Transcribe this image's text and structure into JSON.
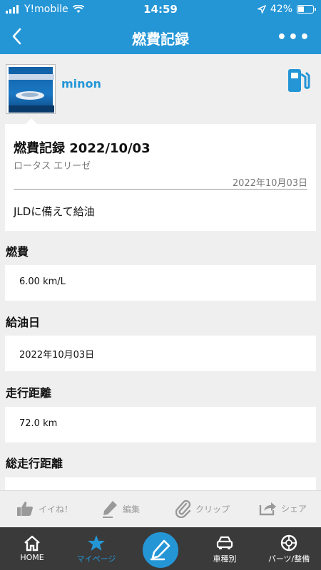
{
  "status": {
    "carrier": "Y!mobile",
    "time": "14:59",
    "battery": "42%",
    "battery_level": 0.42
  },
  "nav": {
    "title": "燃費記録",
    "more_icon": "•••"
  },
  "profile": {
    "username": "minon"
  },
  "record": {
    "title": "燃費記録 2022/10/03",
    "car": "ロータス エリーゼ",
    "date": "2022年10月03日",
    "comment": "JLDに備えて給油"
  },
  "fields": [
    {
      "label": "燃費",
      "value": "6.00 km/L"
    },
    {
      "label": "給油日",
      "value": "2022年10月03日"
    },
    {
      "label": "走行距離",
      "value": "72.0 km"
    },
    {
      "label": "総走行距離",
      "value": ""
    }
  ],
  "actions": {
    "like": "イイね！",
    "edit": "編集",
    "clip": "クリップ",
    "share": "シェア"
  },
  "tabs": {
    "home": "HOME",
    "mypage": "マイページ",
    "cars": "車種別",
    "parts": "パーツ/整備"
  },
  "colors": {
    "accent": "#2496d6",
    "tabbar": "#3a3a3a"
  }
}
